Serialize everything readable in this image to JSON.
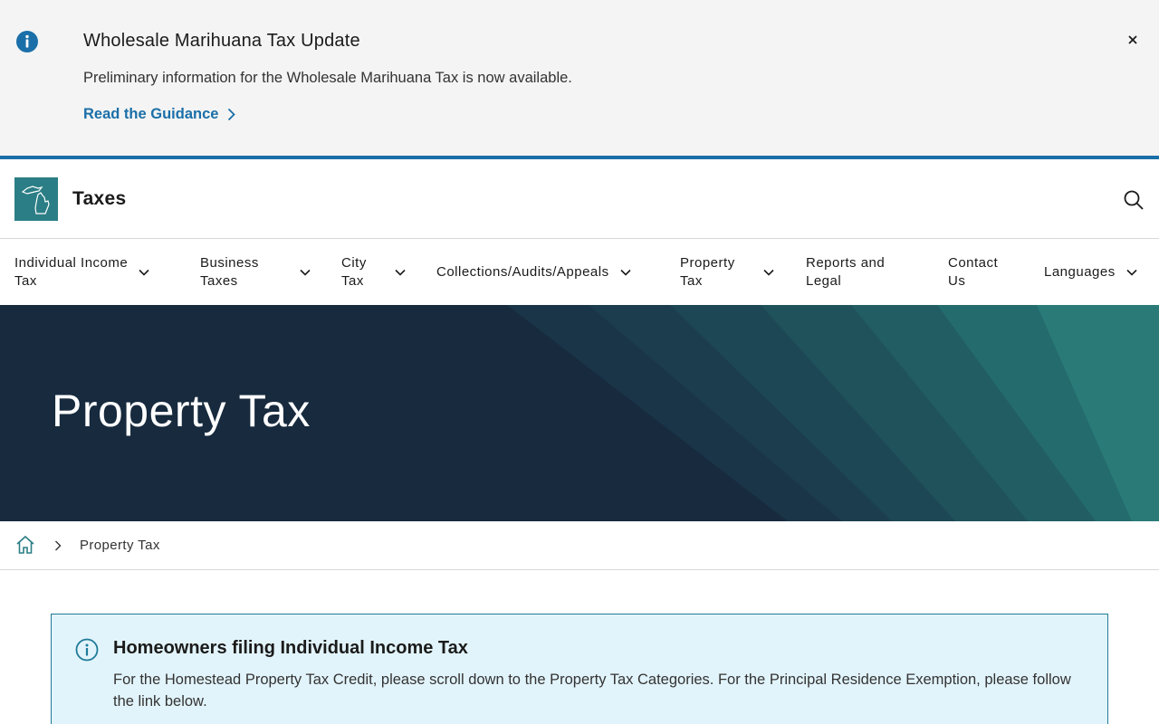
{
  "alert": {
    "title": "Wholesale Marihuana Tax Update",
    "body": "Preliminary information for the Wholesale Marihuana Tax is now available.",
    "link_label": "Read the Guidance",
    "icons": {
      "info": "info-circle-icon",
      "close": "close-icon",
      "link_arrow": "chevron-right-icon"
    }
  },
  "header": {
    "site_title": "Taxes",
    "logo_icon": "michigan-map-icon",
    "search_icon": "search-icon"
  },
  "nav": {
    "items": [
      {
        "label": "Individual Income\nTax",
        "has_dropdown": true
      },
      {
        "label": "Business\nTaxes",
        "has_dropdown": true
      },
      {
        "label": "City\nTax",
        "has_dropdown": true
      },
      {
        "label": "Collections/Audits/Appeals",
        "has_dropdown": true
      },
      {
        "label": "Property\nTax",
        "has_dropdown": true
      },
      {
        "label": "Reports and\nLegal",
        "has_dropdown": false
      },
      {
        "label": "Contact\nUs",
        "has_dropdown": false
      },
      {
        "label": "Languages",
        "has_dropdown": true
      }
    ]
  },
  "hero": {
    "title": "Property Tax"
  },
  "breadcrumb": {
    "home_icon": "home-icon",
    "current": "Property Tax"
  },
  "notice": {
    "title": "Homeowners filing Individual Income Tax",
    "body": "For the Homestead Property Tax Credit, please scroll down to the Property Tax Categories. For the Principal Residence Exemption, please follow the link below."
  },
  "colors": {
    "brand_teal": "#2b7e85",
    "link_blue": "#1a6fa8",
    "hero_navy": "#172a3e",
    "notice_bg": "#e2f4fb",
    "notice_border": "#1f7a99"
  }
}
